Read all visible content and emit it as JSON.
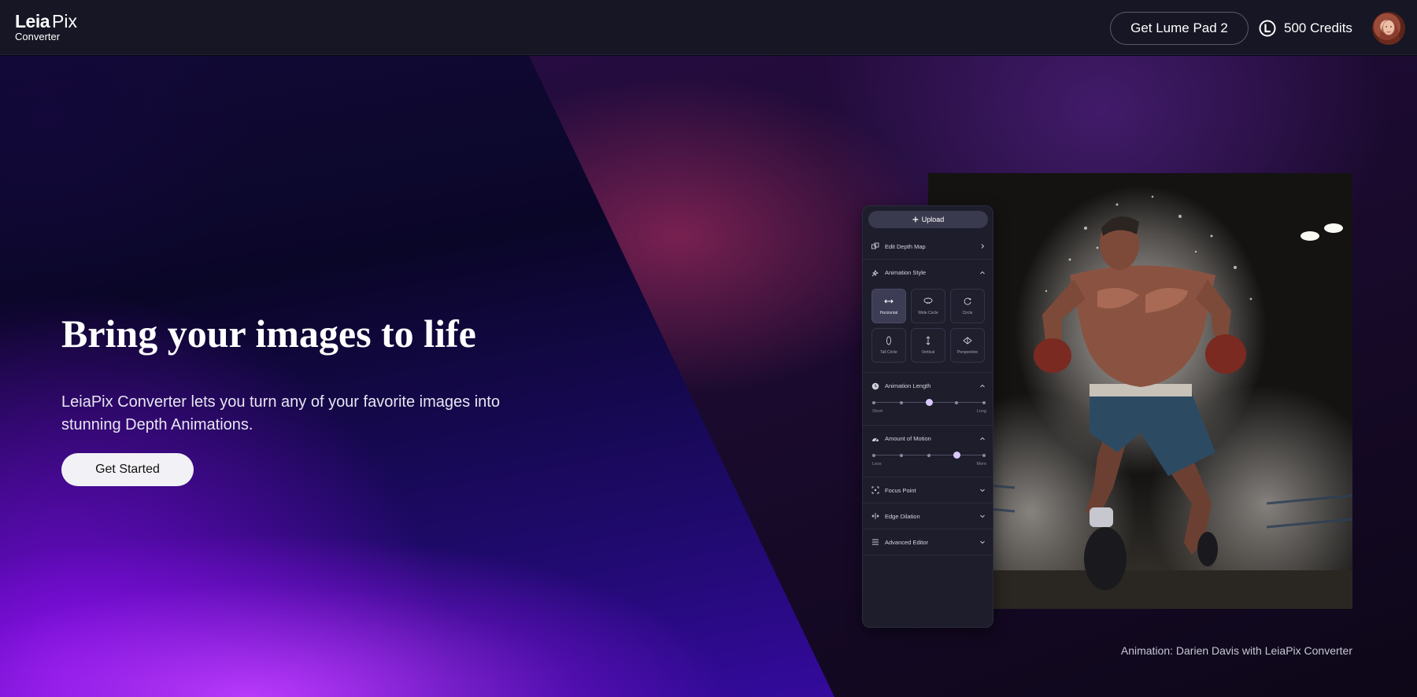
{
  "header": {
    "logo": {
      "brand": "Leia",
      "product": "Pix",
      "sub": "Converter"
    },
    "lume_button_label": "Get Lume Pad 2",
    "credits_label": "500 Credits"
  },
  "hero": {
    "title": "Bring your images to life",
    "description": "LeiaPix Converter lets you turn any of your favorite images into stunning Depth Animations.",
    "cta_label": "Get Started",
    "caption": "Animation: Darien Davis with LeiaPix Converter"
  },
  "panel": {
    "upload_label": "Upload",
    "edit_depth_map_label": "Edit Depth Map",
    "animation_style": {
      "label": "Animation Style",
      "options": [
        "Horizontal",
        "Wide Circle",
        "Circle",
        "Tall Circle",
        "Vertical",
        "Perspective"
      ],
      "selected": "Horizontal"
    },
    "animation_length": {
      "label": "Animation Length",
      "min_label": "Short",
      "max_label": "Long",
      "value_fraction": 0.5
    },
    "amount_of_motion": {
      "label": "Amount of Motion",
      "min_label": "Less",
      "max_label": "More",
      "value_fraction": 0.75
    },
    "focus_point_label": "Focus Point",
    "edge_dilation_label": "Edge Dilation",
    "advanced_editor_label": "Advanced Editor"
  },
  "colors": {
    "header_bg": "#161624",
    "panel_bg": "#1d1d2b",
    "accent_purple": "#8a1eff",
    "slider_thumb": "#d9c9ff",
    "cta_bg": "#f2f1f6"
  },
  "icons": {
    "credits": "leia-credit-coin-icon",
    "upload": "plus-icon",
    "edit_depth_map": "depth-map-icon",
    "animation_style": "sparkle-icon",
    "animation_length": "clock-icon",
    "amount_of_motion": "motion-icon",
    "focus_point": "focus-icon",
    "edge_dilation": "edge-dilation-icon",
    "advanced_editor": "sliders-icon"
  }
}
